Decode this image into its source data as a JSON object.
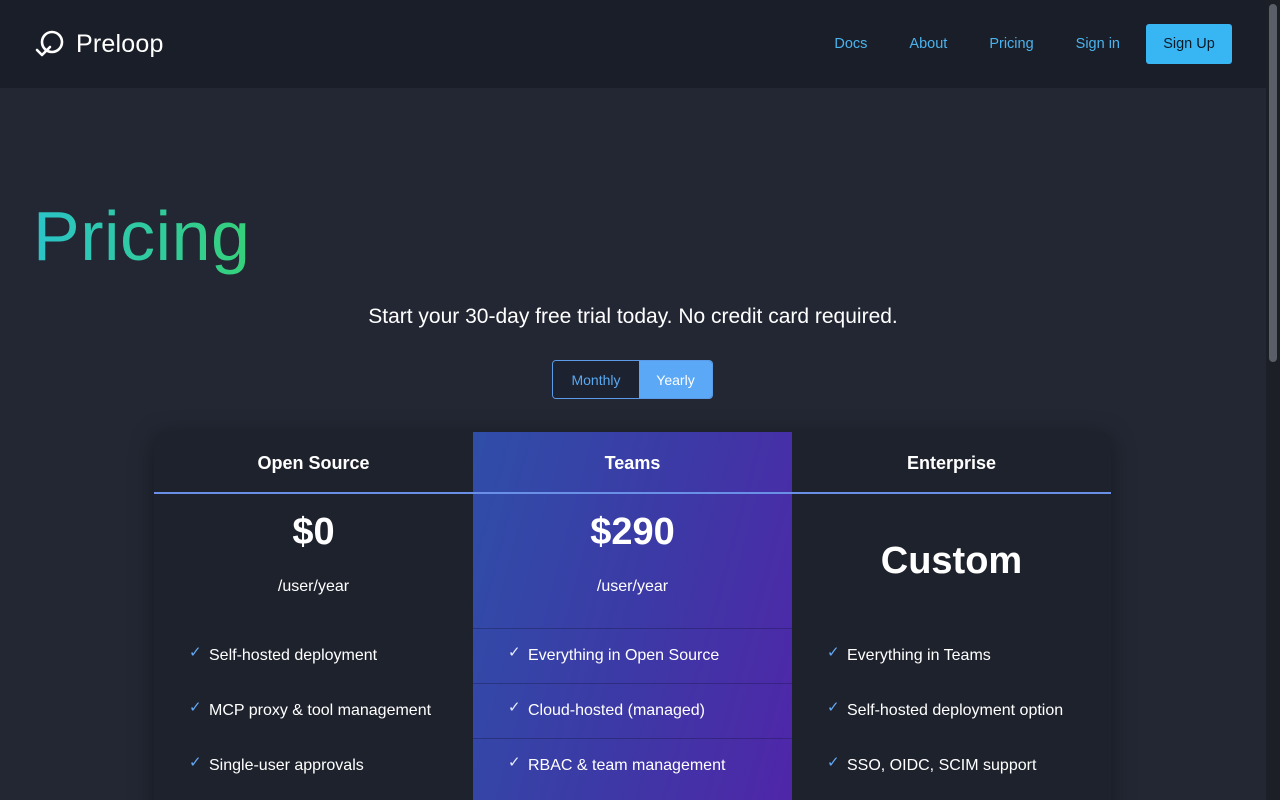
{
  "brand": {
    "name": "Preloop"
  },
  "nav": {
    "items": [
      "Docs",
      "About",
      "Pricing",
      "Sign in"
    ],
    "signup_label": "Sign Up"
  },
  "hero": {
    "title": "Pricing",
    "subtitle": "Start your 30-day free trial today. No credit card required."
  },
  "billing_toggle": {
    "options": [
      "Monthly",
      "Yearly"
    ],
    "selected": "Yearly"
  },
  "plans": [
    {
      "name": "Open Source",
      "price": "$0",
      "period": "/user/year",
      "features": [
        "Self-hosted deployment",
        "MCP proxy & tool management",
        "Single-user approvals"
      ]
    },
    {
      "name": "Teams",
      "price": "$290",
      "period": "/user/year",
      "features": [
        "Everything in Open Source",
        "Cloud-hosted (managed)",
        "RBAC & team management"
      ]
    },
    {
      "name": "Enterprise",
      "price": "Custom",
      "features": [
        "Everything in Teams",
        "Self-hosted deployment option",
        "SSO, OIDC, SCIM support"
      ]
    }
  ],
  "colors": {
    "header_bg": "#1a1e28",
    "page_bg": "#222733",
    "accent": "#38b6f4",
    "link": "#4ab3ee",
    "title_gradient_start": "#2bc3c8",
    "title_gradient_end": "#35d17a"
  },
  "icons": {
    "logo": "loop-check-icon",
    "feature": "checkmark-icon"
  }
}
